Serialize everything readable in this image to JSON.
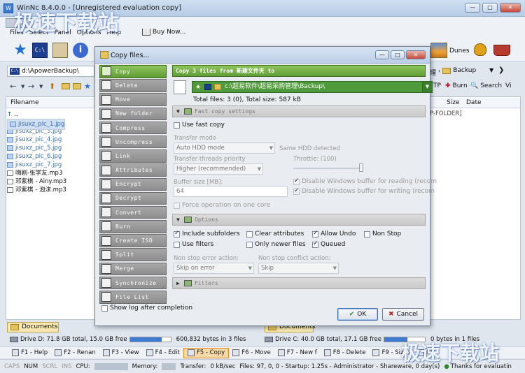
{
  "window": {
    "title": "WinNc 8.4.0.0 - [Unregistered evaluation copy]"
  },
  "menu": {
    "items": [
      "Files",
      "Select",
      "Panel",
      "Options",
      "Help"
    ],
    "buy_now": "Buy Now..."
  },
  "toolbar": {
    "dunes_label": "Dunes"
  },
  "left_panel": {
    "drive": "C:\\",
    "path": "d:\\ApowerBackup\\",
    "column_filename": "Filename",
    "files": [
      {
        "name": "..",
        "type": "up"
      },
      {
        "name": "jisuxz_pic_1.jpg",
        "type": "jpg",
        "selected": true
      },
      {
        "name": "jisuxz_pic_2.jpg",
        "type": "jpg"
      },
      {
        "name": "jisuxz_pic_3.jpg",
        "type": "jpg"
      },
      {
        "name": "jisuxz_pic_4.jpg",
        "type": "jpg"
      },
      {
        "name": "jisuxz_pic_5.jpg",
        "type": "jpg"
      },
      {
        "name": "jisuxz_pic_6.jpg",
        "type": "jpg"
      },
      {
        "name": "jisuxz_pic_7.jpg",
        "type": "jpg"
      },
      {
        "name": "嗨剧-张学友.mp3",
        "type": "mp3"
      },
      {
        "name": "邓紫棋 - Ainy.mp3",
        "type": "mp3"
      },
      {
        "name": "邓紫棋 - 泡沫.mp3",
        "type": "mp3"
      }
    ],
    "tab_label": "Documents",
    "drive_info": "Drive D: 71.8 GB total, 15.0 GB free",
    "bytes_info": "600,832 bytes in 3 files",
    "drive_used_fraction": 0.79
  },
  "right_panel": {
    "path_end": "理",
    "path_folder": "Backup",
    "ftp_label": "FTP",
    "burn_label": "Burn",
    "search_label": "Search",
    "view_label": "Vi",
    "column_size": "Size",
    "column_date": "Date",
    "folder_note": "P-FOLDER]",
    "tab_label": "Documents",
    "drive_info": "Drive C: 40.0 GB total, 17.1 GB free",
    "bytes_info": "0 bytes in 1 files",
    "drive_used_fraction": 0.57
  },
  "fkeys": [
    {
      "label": "F1 - Help"
    },
    {
      "label": "F2 - Renan"
    },
    {
      "label": "F3 - View"
    },
    {
      "label": "F4 - Edit"
    },
    {
      "label": "F5 - Copy",
      "active": true
    },
    {
      "label": "F6 - Move"
    },
    {
      "label": "F7 - New f"
    },
    {
      "label": "F8 - Delete"
    },
    {
      "label": "F9 - Sizes"
    },
    {
      "label": "F1"
    }
  ],
  "statusbar": {
    "caps": "CAPS",
    "num": "NUM",
    "scrl": "SCRL",
    "ins": "INS",
    "cpu_label": "CPU:",
    "memory_label": "Memory:",
    "transfer_label": "Transfer:",
    "transfer_value": "0 kB/sec",
    "files_info": "Files: 97, 0, 0 - Startup: 1.25s - Administrator - Shareware, 0 day(s)",
    "thanks": "Thanks for evaluatin"
  },
  "dialog": {
    "title": "Copy files...",
    "operations": [
      "Copy",
      "Delete",
      "Move",
      "New folder",
      "Compress",
      "Uncompress",
      "Link",
      "Attributes",
      "Encrypt",
      "Decrypt",
      "Convert",
      "Burn",
      "Create ISO",
      "Split",
      "Merge",
      "Synchronize",
      "File List"
    ],
    "active_operation": 0,
    "header": "Copy 3 files from 新建文件夹 to",
    "destination": "c:\\超易软件\\超易采购管理\\Backup\\",
    "totals": "Total files: 3 (0), Total size: 587 kB",
    "fast_copy": {
      "section_label": "Fast copy settings",
      "use_fast_copy": "Use fast copy",
      "transfer_mode_label": "Transfer mode",
      "transfer_mode_value": "Auto HDD mode",
      "same_hdd": "Same HDD detected",
      "threads_label": "Transfer threads priority",
      "threads_value": "Higher (recommended)",
      "throttle_label": "Throttle: (100)",
      "throttle_fraction": 1.0,
      "buffer_label": "Buffer size [MB]:",
      "buffer_value": "64",
      "disable_read": "Disable Windows buffer for reading (recom",
      "disable_write": "Disable Windows buffer for writing  (recom",
      "force_one_core": "Force operation on one core"
    },
    "options": {
      "section_label": "Options",
      "include_subfolders": "Include subfolders",
      "clear_attributes": "Clear attributes",
      "allow_undo": "Allow Undo",
      "non_stop": "Non Stop",
      "use_filters": "Use filters",
      "only_newer": "Only newer files",
      "queued": "Queued",
      "non_stop_error_label": "Non stop error action:",
      "non_stop_error_value": "Skip on error",
      "non_stop_conflict_label": "Non stop conflict action:",
      "non_stop_conflict_value": "Skip"
    },
    "filters": {
      "section_label": "Filters"
    },
    "show_log": "Show log after completion",
    "ok_label": "OK",
    "cancel_label": "Cancel"
  },
  "watermark": {
    "text": "极速下载站"
  }
}
